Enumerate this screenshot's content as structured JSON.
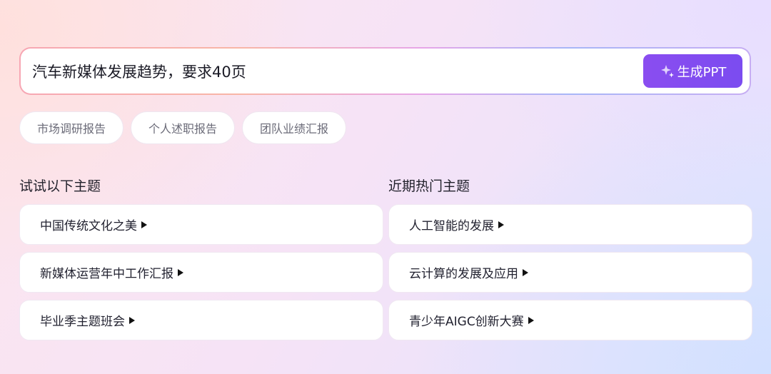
{
  "search": {
    "value": "汽车新媒体发展趋势，要求40页",
    "button_label": "生成PPT",
    "button_icon": "sparkle-icon"
  },
  "chips": [
    {
      "label": "市场调研报告"
    },
    {
      "label": "个人述职报告"
    },
    {
      "label": "团队业绩汇报"
    }
  ],
  "try_topics": {
    "title": "试试以下主题",
    "items": [
      {
        "label": "中国传统文化之美"
      },
      {
        "label": "新媒体运营年中工作汇报"
      },
      {
        "label": "毕业季主题班会"
      }
    ]
  },
  "hot_topics": {
    "title": "近期热门主题",
    "items": [
      {
        "label": "人工智能的发展"
      },
      {
        "label": "云计算的发展及应用"
      },
      {
        "label": "青少年AIGC创新大赛"
      }
    ]
  },
  "colors": {
    "accent": "#8a4df0",
    "card_bg": "#ffffff",
    "chip_text": "#6b6b78"
  }
}
